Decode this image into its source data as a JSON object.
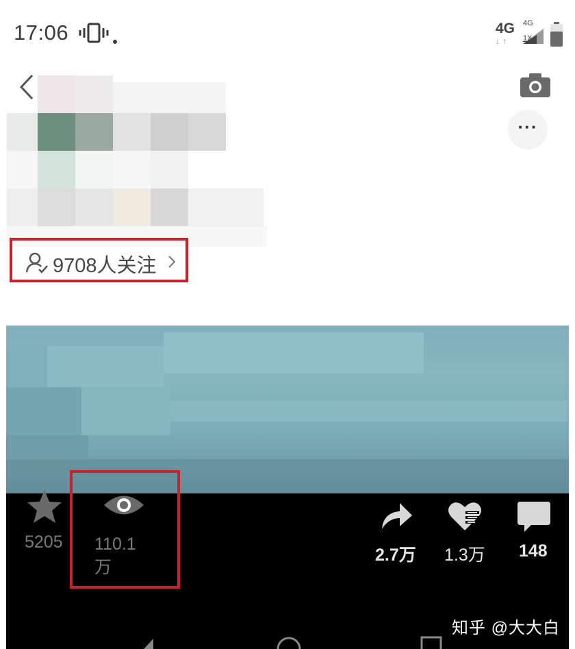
{
  "status_bar": {
    "time": "17:06",
    "network": "4G",
    "network_small": "4G",
    "network_1x": "1X",
    "arrows": "↓↑",
    "icons": [
      "vibrate-icon",
      "signal-icon",
      "battery-icon"
    ]
  },
  "header": {
    "icons": [
      "back-icon",
      "camera-icon"
    ],
    "more_label": "···"
  },
  "profile": {
    "followers": "9708人关注"
  },
  "video_stats": {
    "stars": "5205",
    "views_line1": "110.1",
    "views_line2": "万",
    "shares": "2.7万",
    "likes": "1.3万",
    "comments": "148"
  },
  "watermark": "知乎 @大大白",
  "colors": {
    "highlight_box": "#c8232c",
    "action_bar_bg": "#000000",
    "video_tint": "#7fb0bb"
  }
}
